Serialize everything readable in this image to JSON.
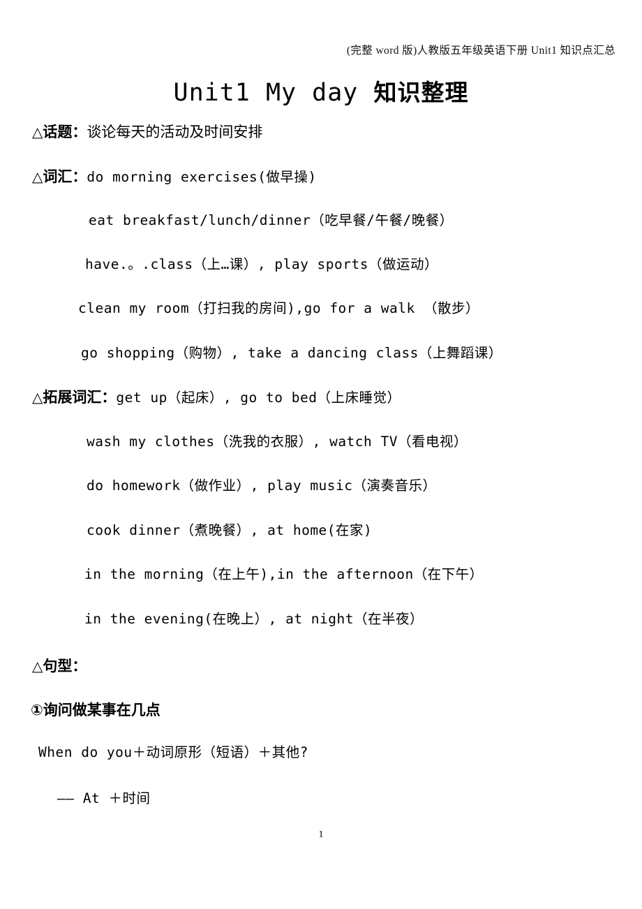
{
  "header": {
    "running_head": "(完整 word 版)人教版五年级英语下册 Unit1 知识点汇总"
  },
  "title": {
    "english": "Unit1  My  day",
    "chinese": "知识整理"
  },
  "sections": {
    "topic": {
      "marker": "△",
      "label": "话题：",
      "content": "谈论每天的活动及时间安排"
    },
    "vocabulary": {
      "marker": "△",
      "label": "词汇：",
      "first_line": "do  morning  exercises(做早操)",
      "lines": [
        "eat  breakfast/lunch/dinner（吃早餐/午餐/晚餐）",
        "have.。.class（上…课）, play  sports（做运动）",
        "clean my room（打扫我的房间),go for a walk （散步）",
        "go  shopping（购物）, take a dancing class（上舞蹈课）"
      ]
    },
    "extended_vocabulary": {
      "marker": "△",
      "label": "拓展词汇：",
      "first_line": "get  up（起床）,  go  to  bed（上床睡觉）",
      "lines": [
        "wash my clothes（洗我的衣服）,  watch TV（看电视）",
        "do homework（做作业）,  play music（演奏音乐）",
        "cook dinner（煮晚餐）,  at home(在家)",
        "in the morning（在上午),in the afternoon（在下午）",
        "in the evening(在晚上）, at night（在半夜）"
      ]
    },
    "sentence_patterns": {
      "marker": "△",
      "label": "句型：",
      "item1": {
        "number": "①",
        "heading": "询问做某事在几点",
        "question": "When do you＋动词原形（短语）＋其他?",
        "answer": "—— At ＋时间"
      }
    }
  },
  "footer": {
    "page_number": "1"
  }
}
